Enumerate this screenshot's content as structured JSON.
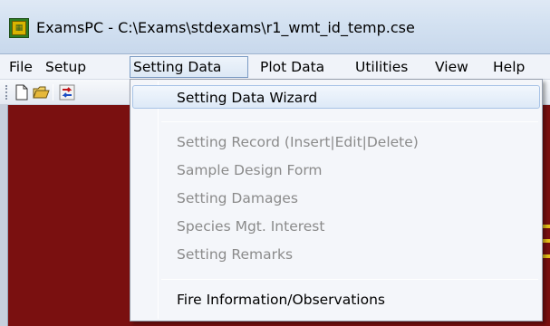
{
  "window": {
    "title": "ExamsPC - C:\\Exams\\stdexams\\r1_wmt_id_temp.cse",
    "icon": "exams-app-icon"
  },
  "menubar": {
    "items": [
      {
        "label": "File"
      },
      {
        "label": "Setup"
      },
      {
        "label": "Setting Data",
        "active": true
      },
      {
        "label": "Plot Data"
      },
      {
        "label": "Utilities"
      },
      {
        "label": "View"
      },
      {
        "label": "Help"
      }
    ]
  },
  "toolbar": {
    "buttons": [
      {
        "icon": "new-file-icon"
      },
      {
        "icon": "open-folder-icon"
      },
      {
        "icon": "refresh-arrows-icon"
      }
    ]
  },
  "dropdown": {
    "items": [
      {
        "label": "Setting Data Wizard",
        "enabled": true,
        "highlighted": true
      },
      {
        "label": "Setting Record (Insert|Edit|Delete)",
        "enabled": false
      },
      {
        "label": "Sample Design Form",
        "enabled": false
      },
      {
        "label": "Setting Damages",
        "enabled": false
      },
      {
        "label": "Species Mgt. Interest",
        "enabled": false
      },
      {
        "label": "Setting Remarks",
        "enabled": false
      },
      {
        "label": "Fire Information/Observations",
        "enabled": true
      }
    ]
  },
  "colors": {
    "workarea": "#7a1010",
    "accent_gold": "#e8c21a",
    "menu_highlight_border": "#7a9ac3"
  }
}
